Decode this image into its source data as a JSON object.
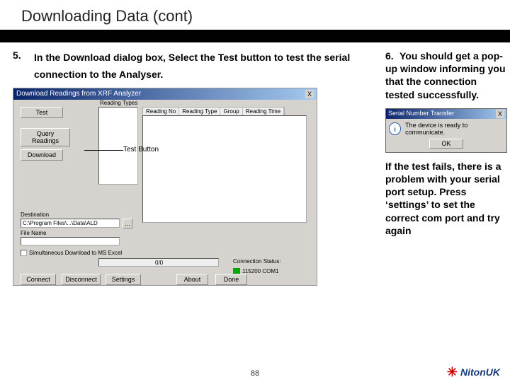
{
  "slide": {
    "title": "Downloading Data (cont)",
    "step5_num": "5.",
    "step5_text": "In the Download dialog box, Select the Test button to test the serial connection to the Analyser.",
    "page_number": "88"
  },
  "right": {
    "n6": "6.",
    "p6": "You should get a pop-up window informing you that the connection tested successfully.",
    "p_fail": "If the test fails, there is a problem with your serial port setup. Press ‘settings’ to set the correct com port and try again"
  },
  "dialog": {
    "title": "Download Readings from XRF Analyzer",
    "close": "X",
    "test_btn": "Test",
    "query_btn": "Query Readings",
    "download_btn": "Download",
    "callout": "Test Button",
    "headers": {
      "a": "Reading No",
      "b": "Reading Type",
      "c": "Group",
      "d": "Reading Time"
    },
    "reading_types": "Reading Types",
    "dest_label": "Destination",
    "dest_value": "C:\\Program Files\\...\\Data\\ALD",
    "browse": "...",
    "file_label": "File Name",
    "checkbox": "Simultaneous Download to MS Excel",
    "progress": "0/0",
    "conn_label": "Connection Status:",
    "conn_value": "115200 COM1",
    "b_connect": "Connect",
    "b_disconnect": "Disconnect",
    "b_settings": "Settings",
    "b_about": "About",
    "b_done": "Done"
  },
  "popup": {
    "title": "Serial Number Transfer",
    "close": "X",
    "msg": "The device is ready to communicate.",
    "ok": "OK"
  },
  "brand": {
    "name": "NitonUK"
  }
}
